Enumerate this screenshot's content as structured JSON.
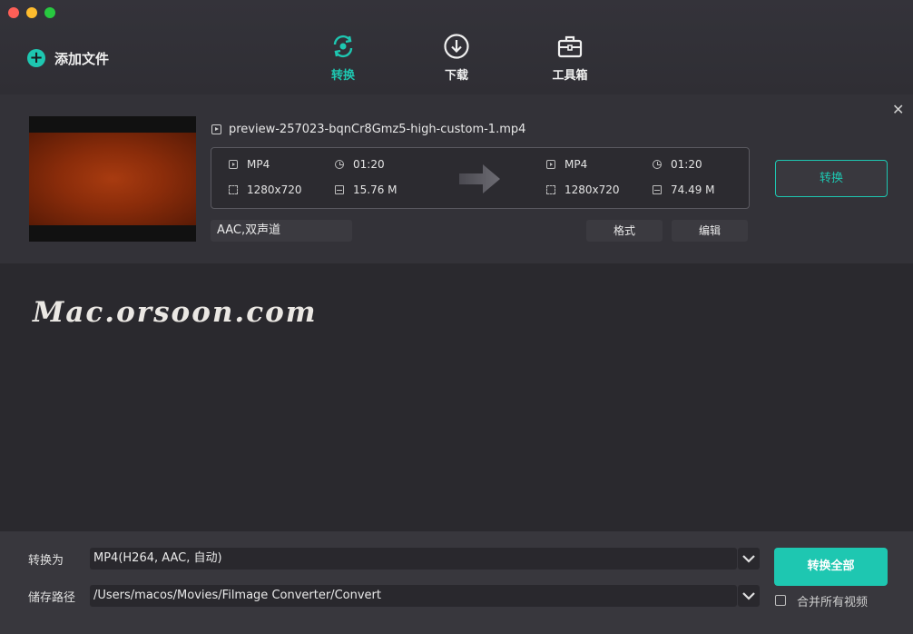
{
  "toolbar": {
    "add_file_label": "添加文件",
    "tabs": [
      {
        "label": "转换",
        "icon": "convert-icon",
        "active": true
      },
      {
        "label": "下载",
        "icon": "download-icon",
        "active": false
      },
      {
        "label": "工具箱",
        "icon": "toolbox-icon",
        "active": false
      }
    ]
  },
  "file": {
    "name": "preview-257023-bqnCr8Gmz5-high-custom-1.mp4",
    "source": {
      "format": "MP4",
      "duration": "01:20",
      "resolution": "1280x720",
      "size": "15.76 M"
    },
    "target": {
      "format": "MP4",
      "duration": "01:20",
      "resolution": "1280x720",
      "size": "74.49 M"
    },
    "audio": "AAC,双声道",
    "format_button": "格式",
    "edit_button": "编辑",
    "convert_button": "转换"
  },
  "watermark": "Mac.orsoon.com",
  "bottom": {
    "convert_to_label": "转换为",
    "convert_to_value": "MP4(H264, AAC, 自动)",
    "save_path_label": "储存路径",
    "save_path_value": "/Users/macos/Movies/Filmage Converter/Convert",
    "convert_all_button": "转换全部",
    "merge_label": "合并所有视频"
  },
  "colors": {
    "accent": "#1ec7b1",
    "background": "#2a292e",
    "panel": "#333238"
  }
}
